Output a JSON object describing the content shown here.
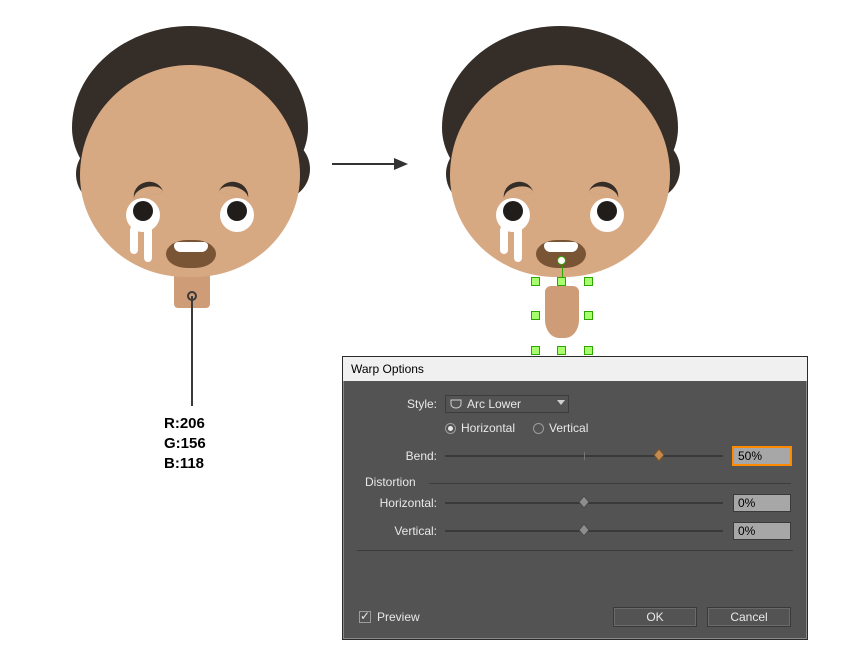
{
  "color_callout": {
    "r_label": "R:206",
    "g_label": "G:156",
    "b_label": "B:118",
    "hex": "#ce9c76"
  },
  "dialog": {
    "title": "Warp Options",
    "style_label": "Style:",
    "style_value": "Arc Lower",
    "orientation": {
      "horizontal_label": "Horizontal",
      "vertical_label": "Vertical",
      "selected": "Horizontal"
    },
    "bend": {
      "label": "Bend:",
      "value": "50%"
    },
    "distortion": {
      "section_label": "Distortion",
      "horizontal": {
        "label": "Horizontal:",
        "value": "0%"
      },
      "vertical": {
        "label": "Vertical:",
        "value": "0%"
      }
    },
    "preview": {
      "label": "Preview",
      "checked": true
    },
    "buttons": {
      "ok": "OK",
      "cancel": "Cancel"
    }
  }
}
